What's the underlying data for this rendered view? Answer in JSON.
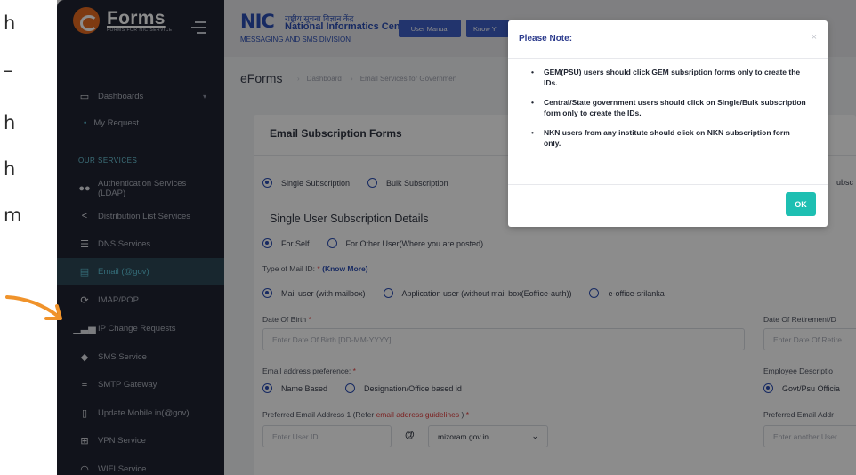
{
  "left_text": [
    "h",
    "–",
    "h",
    "h",
    "m"
  ],
  "brand": {
    "title": "Forms",
    "subtitle": "FORMS FOR NIC SERVICE"
  },
  "topbar": {
    "nic_mark": "NIC",
    "nic_hindi": "राष्ट्रीय सूचना विज्ञान केंद्र",
    "nic_english": "National Informatics Centre",
    "nic_division": "MESSAGING AND SMS DIVISION",
    "user_manual": "User Manual",
    "know_your": "Know Y"
  },
  "sidebar": {
    "dashboards": "Dashboards",
    "my_request": "My Request",
    "section": "OUR SERVICES",
    "items": [
      {
        "label": "Authentication Services (LDAP)",
        "icon": "users-icon"
      },
      {
        "label": "Distribution List Services",
        "icon": "share-icon"
      },
      {
        "label": "DNS Services",
        "icon": "dns-icon"
      },
      {
        "label": "Email (@gov)",
        "icon": "email-icon",
        "active": true
      },
      {
        "label": "IMAP/POP",
        "icon": "sync-icon"
      },
      {
        "label": "IP Change Requests",
        "icon": "signal-icon"
      },
      {
        "label": "SMS Service",
        "icon": "sms-icon"
      },
      {
        "label": "SMTP Gateway",
        "icon": "server-icon"
      },
      {
        "label": "Update Mobile in(@gov)",
        "icon": "mobile-icon"
      },
      {
        "label": "VPN Service",
        "icon": "network-icon"
      },
      {
        "label": "WIFI Service",
        "icon": "wifi-icon"
      }
    ]
  },
  "content": {
    "page_title": "eForms",
    "breadcrumb": [
      "Dashboard",
      "Email Services for Governmen"
    ],
    "card_title": "Email Subscription Forms",
    "subscription_options": [
      "Single Subscription",
      "Bulk Subscription"
    ],
    "subscription_right": "ubsc",
    "section_heading": "Single User Subscription Details",
    "for_options": [
      "For Self",
      "For Other User(Where you are posted)"
    ],
    "mail_id_type_label": "Type of Mail ID: ",
    "know_more": "(Know More)",
    "mail_options": [
      "Mail user (with mailbox)",
      "Application user (without mail box(Eoffice-auth))",
      "e-office-srilanka"
    ],
    "dob_label": "Date Of Birth ",
    "dob_placeholder": "Enter Date Of Birth [DD-MM-YYYY]",
    "retirement_label": "Date Of Retirement/D",
    "retirement_placeholder": "Enter Date Of Retire",
    "email_pref_label": "Email address preference: ",
    "email_pref_options": [
      "Name Based",
      "Designation/Office based id"
    ],
    "emp_desc_label": "Employee Descriptio",
    "emp_desc_option": "Govt/Psu Officia",
    "pref_email1_label_a": "Preferred Email Address 1 (Refer ",
    "pref_email1_link": "email address guidelines",
    "pref_email1_label_b": " ) ",
    "user_id_placeholder": "Enter User ID",
    "at_sign": "@",
    "domain_value": "mizoram.gov.in",
    "pref_email2_label": "Preferred Email Addr",
    "pref_email2_placeholder": "Enter another User"
  },
  "modal": {
    "title": "Please Note:",
    "close": "×",
    "notes": [
      "GEM(PSU) users should click GEM subsription forms only to create the IDs.",
      "Central/State government users should click on Single/Bulk subscription form only to create the IDs.",
      "NKN users from any institute should click on NKN subscription form only."
    ],
    "ok_label": "OK"
  },
  "colors": {
    "sidebar": "#1f2332",
    "accent": "#2b4db3",
    "ok": "#1ebfb2",
    "active": "#5ec3d8",
    "arrow": "#f0932b"
  }
}
